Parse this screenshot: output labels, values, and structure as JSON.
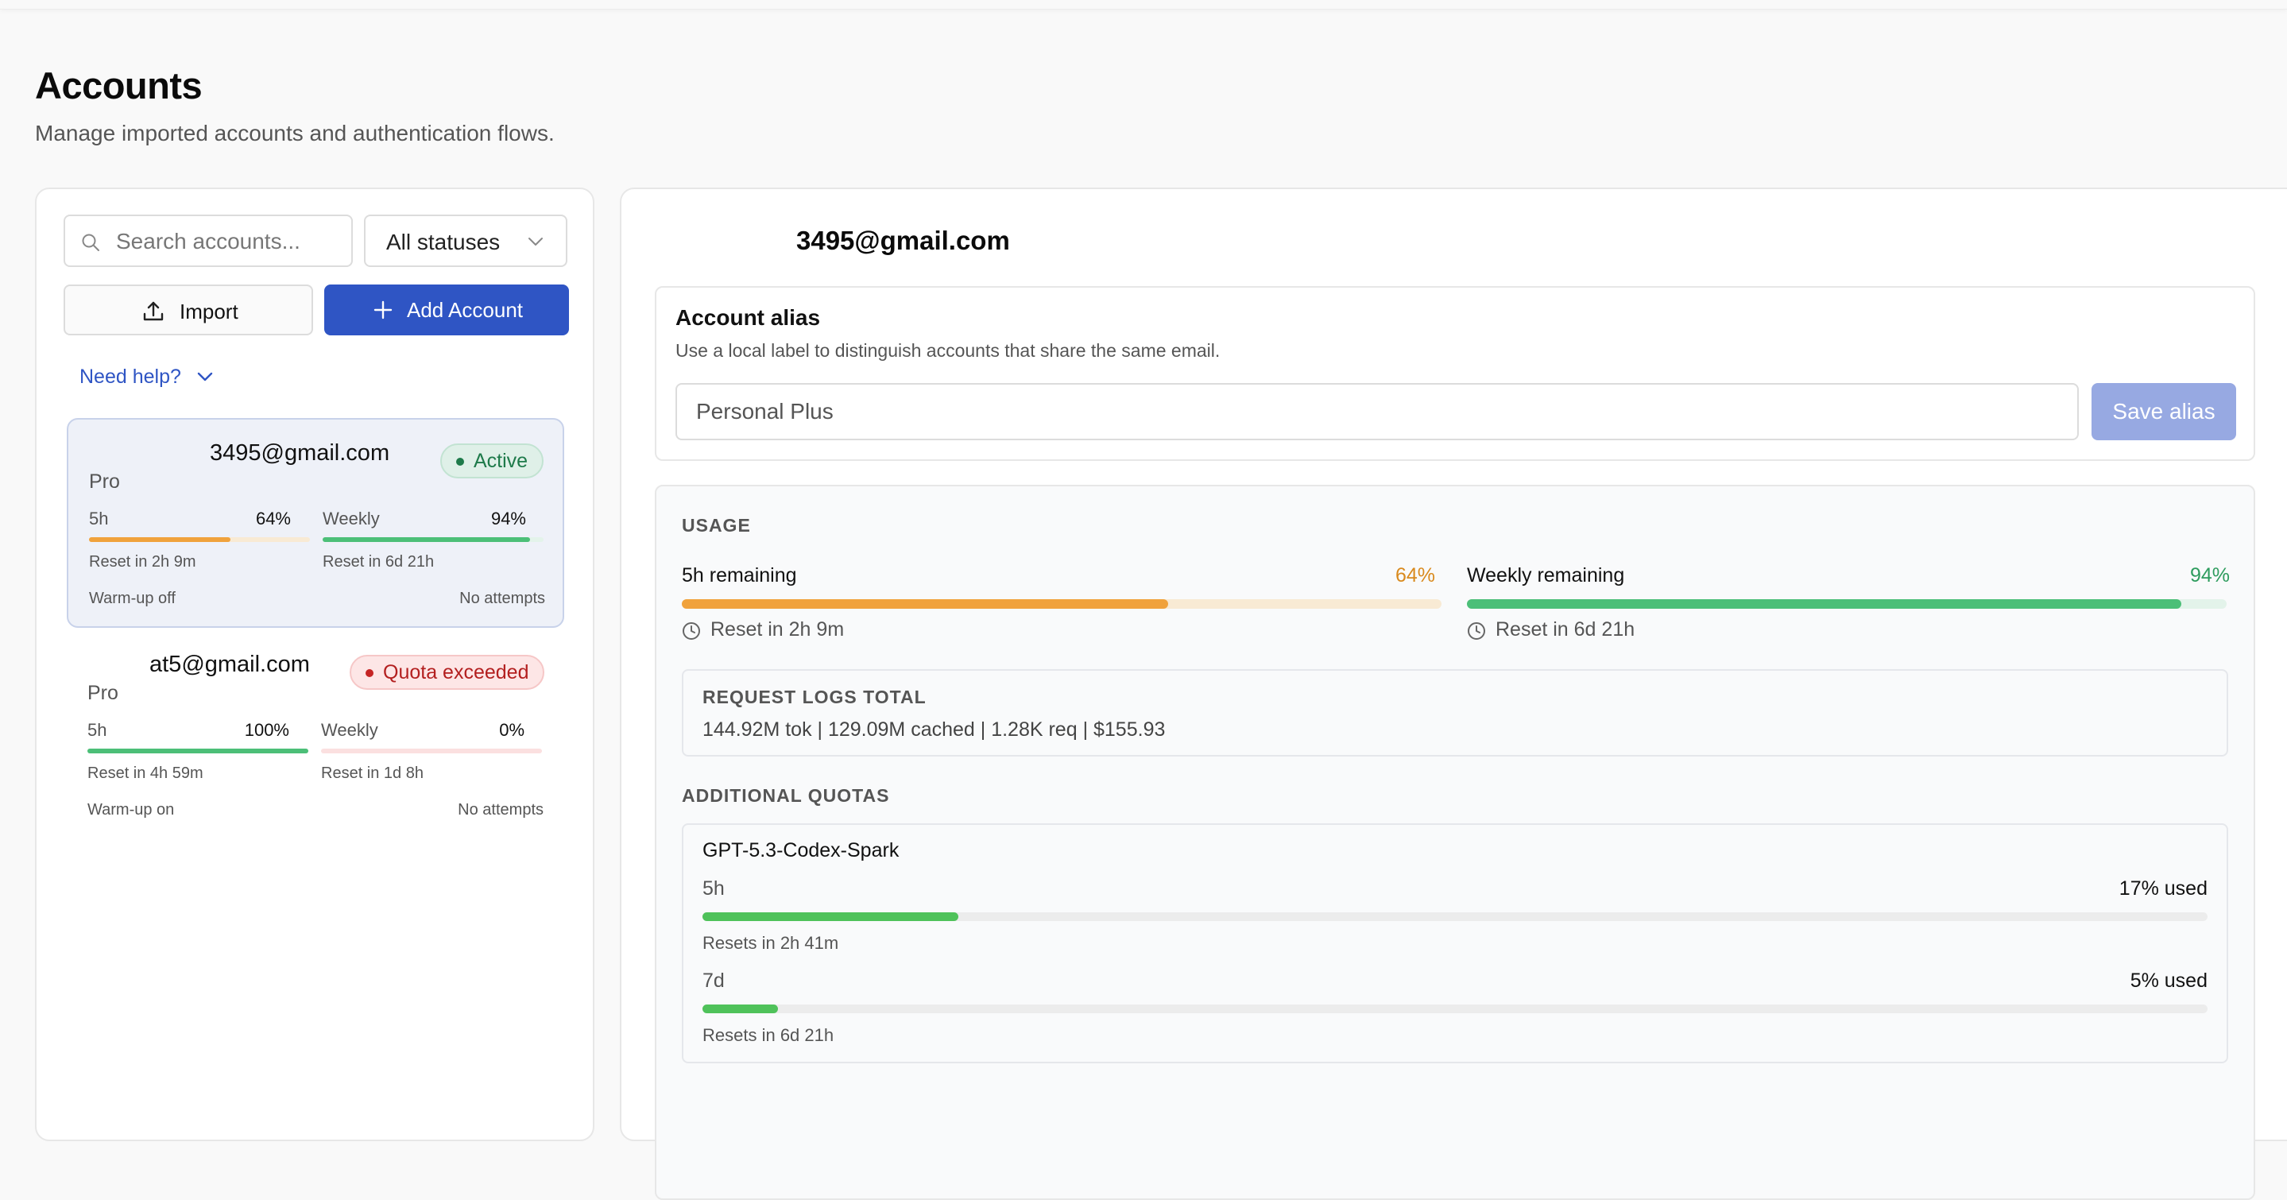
{
  "header": {
    "title": "Accounts",
    "subtitle": "Manage imported accounts and authentication flows."
  },
  "toolbar": {
    "search_placeholder": "Search accounts...",
    "status_filter": "All statuses",
    "import_label": "Import",
    "add_label": "Add Account",
    "help_label": "Need help?"
  },
  "accounts": [
    {
      "email": "3495@gmail.com",
      "plan": "Pro",
      "status": "Active",
      "h5_label": "5h",
      "h5_pct": "64%",
      "h5_fill": 0.64,
      "h5_reset": "Reset in 2h 9m",
      "weekly_label": "Weekly",
      "weekly_pct": "94%",
      "weekly_fill": 0.94,
      "weekly_reset": "Reset in 6d 21h",
      "warmup": "Warm-up off",
      "attempts": "No attempts"
    },
    {
      "email": "at5@gmail.com",
      "plan": "Pro",
      "status": "Quota exceeded",
      "h5_label": "5h",
      "h5_pct": "100%",
      "h5_fill": 1.0,
      "h5_reset": "Reset in 4h 59m",
      "weekly_label": "Weekly",
      "weekly_pct": "0%",
      "weekly_fill": 0.0,
      "weekly_reset": "Reset in 1d 8h",
      "warmup": "Warm-up on",
      "attempts": "No attempts"
    }
  ],
  "detail": {
    "email": "3495@gmail.com",
    "alias": {
      "title": "Account alias",
      "description": "Use a local label to distinguish accounts that share the same email.",
      "value": "Personal Plus",
      "save_label": "Save alias"
    },
    "usage": {
      "section_label": "USAGE",
      "h5": {
        "label": "5h remaining",
        "pct": "64%",
        "fill": 0.64,
        "reset": "Reset in 2h 9m"
      },
      "weekly": {
        "label": "Weekly remaining",
        "pct": "94%",
        "fill": 0.94,
        "reset": "Reset in 6d 21h"
      }
    },
    "logs": {
      "label": "REQUEST LOGS TOTAL",
      "value": "144.92M tok | 129.09M cached | 1.28K req | $155.93"
    },
    "additional": {
      "label": "ADDITIONAL QUOTAS",
      "model": "GPT-5.3-Codex-Spark",
      "rows": [
        {
          "label": "5h",
          "used": "17% used",
          "fill": 0.17,
          "reset": "Resets in 2h 41m"
        },
        {
          "label": "7d",
          "used": "5% used",
          "fill": 0.05,
          "reset": "Resets in 6d 21h"
        }
      ]
    }
  },
  "colors": {
    "accent": "#2f55c4",
    "orange": "#f0a23c",
    "orange_track": "#f8ead4",
    "green": "#4cbf78",
    "green_track": "#e3f3ea",
    "green_quota": "#4fc25a",
    "red_track": "#fbe0e0",
    "active_text": "#1e7a4a",
    "quota_text": "#b31f1f"
  }
}
